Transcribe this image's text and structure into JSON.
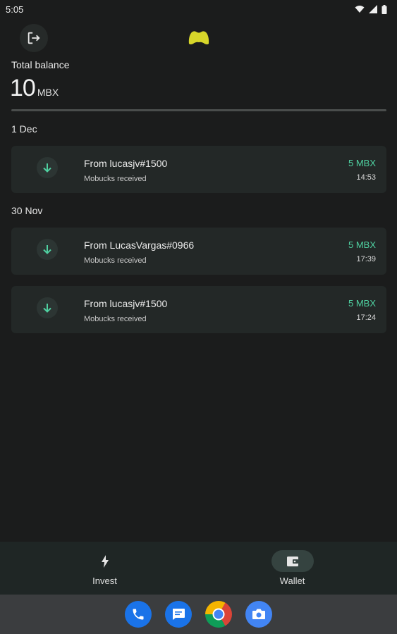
{
  "status_bar": {
    "time": "5:05"
  },
  "header": {
    "logo": "mobucks-logo",
    "logout_icon": "logout-icon"
  },
  "balance": {
    "label": "Total balance",
    "amount": "10",
    "unit": "MBX"
  },
  "groups": [
    {
      "date": "1 Dec",
      "transactions": [
        {
          "title": "From lucasjv#1500",
          "subtitle": "Mobucks received",
          "amount": "5 MBX",
          "time": "14:53"
        }
      ]
    },
    {
      "date": "30 Nov",
      "transactions": [
        {
          "title": "From LucasVargas#0966",
          "subtitle": "Mobucks received",
          "amount": "5 MBX",
          "time": "17:39"
        },
        {
          "title": "From lucasjv#1500",
          "subtitle": "Mobucks received",
          "amount": "5 MBX",
          "time": "17:24"
        }
      ]
    }
  ],
  "bottom_nav": [
    {
      "label": "Invest",
      "icon": "bolt-icon",
      "active": false
    },
    {
      "label": "Wallet",
      "icon": "wallet-icon",
      "active": true
    }
  ],
  "dock": [
    "phone-icon",
    "messages-icon",
    "chrome-icon",
    "camera-icon"
  ],
  "colors": {
    "accent": "#4fd1a1",
    "logo": "#d7d62a",
    "background": "#1b1c1c"
  }
}
